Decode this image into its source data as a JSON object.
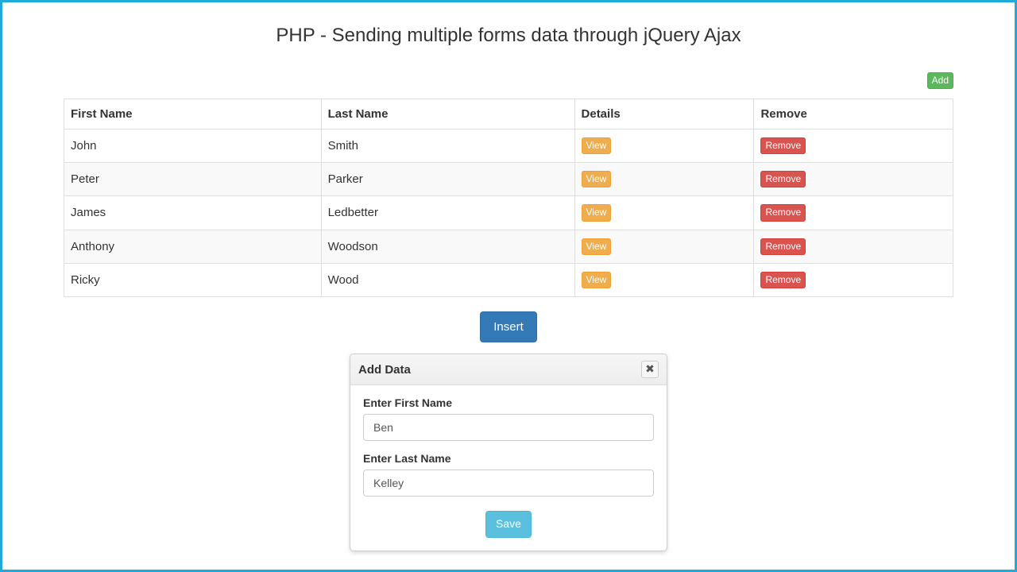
{
  "page": {
    "title": "PHP - Sending multiple forms data through jQuery Ajax",
    "add_button": "Add",
    "insert_button": "Insert"
  },
  "table": {
    "headers": {
      "first_name": "First Name",
      "last_name": "Last Name",
      "details": "Details",
      "remove": "Remove"
    },
    "view_label": "View",
    "remove_label": "Remove",
    "rows": [
      {
        "first_name": "John",
        "last_name": "Smith"
      },
      {
        "first_name": "Peter",
        "last_name": "Parker"
      },
      {
        "first_name": "James",
        "last_name": "Ledbetter"
      },
      {
        "first_name": "Anthony",
        "last_name": "Woodson"
      },
      {
        "first_name": "Ricky",
        "last_name": "Wood"
      }
    ]
  },
  "dialog": {
    "title": "Add Data",
    "first_name_label": "Enter First Name",
    "first_name_value": "Ben",
    "last_name_label": "Enter Last Name",
    "last_name_value": "Kelley",
    "save_button": "Save"
  }
}
